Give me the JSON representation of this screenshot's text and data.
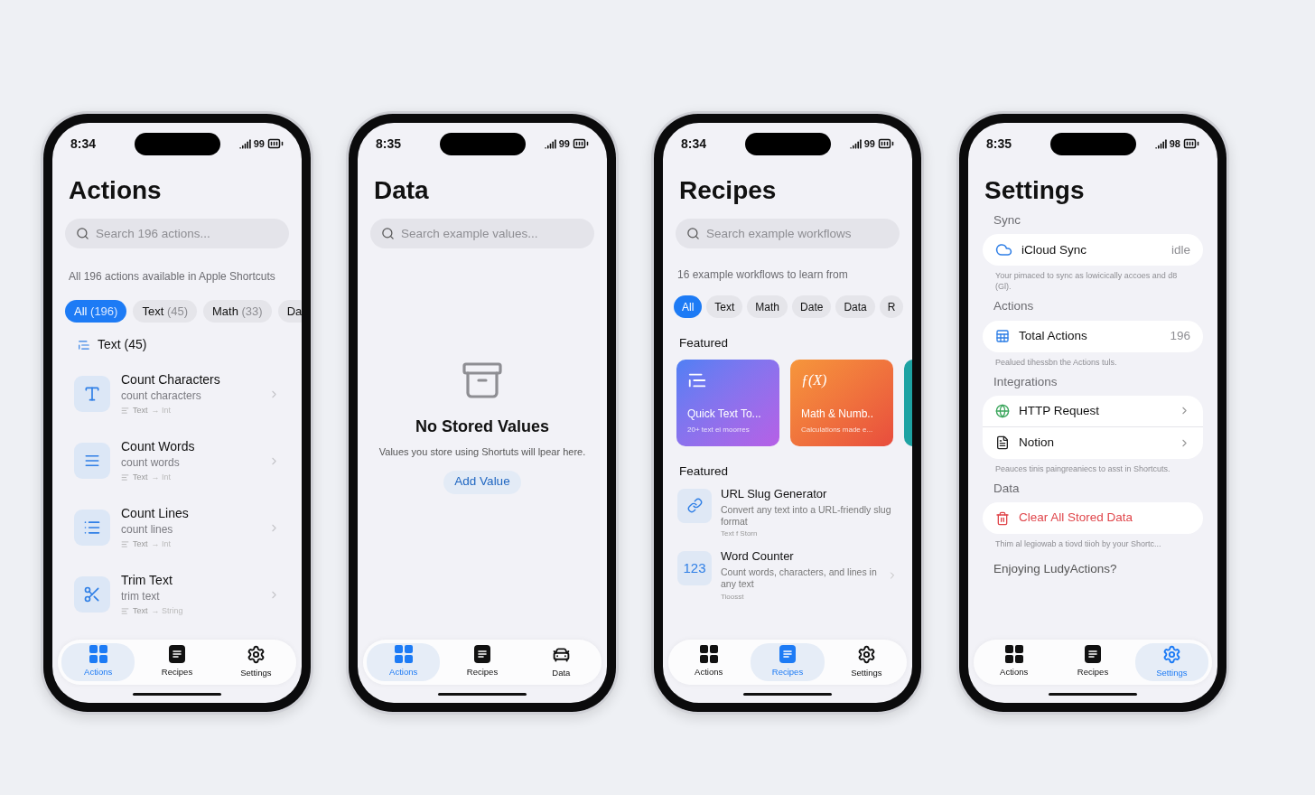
{
  "phones": [
    {
      "kind": "actions",
      "time": "8:34",
      "battery": "99",
      "title": "Actions",
      "search": {
        "placeholder": "Search 196 actions..."
      },
      "subtitle": "All 196 actions available in Apple Shortcuts",
      "chips": [
        {
          "label": "All",
          "count": "(196)",
          "selected": true
        },
        {
          "label": "Text",
          "count": "(45)",
          "selected": false
        },
        {
          "label": "Math",
          "count": "(33)",
          "selected": false
        },
        {
          "label": "Da",
          "selected": false
        }
      ],
      "section": "Text (45)",
      "items": [
        {
          "kind": "characters",
          "title": "Count Characters",
          "subtitle": "count characters",
          "input": "Text",
          "output": "→ Int"
        },
        {
          "kind": "words",
          "title": "Count Words",
          "subtitle": "count words",
          "input": "Text",
          "output": "→ Int"
        },
        {
          "kind": "lines",
          "title": "Count Lines",
          "subtitle": "count lines",
          "input": "Text",
          "output": "→ Int"
        },
        {
          "kind": "trim",
          "title": "Trim Text",
          "subtitle": "trim text",
          "input": "Text",
          "output": "→ String"
        }
      ],
      "tabs": [
        {
          "kind": "actions",
          "label": "Actions",
          "selected": true
        },
        {
          "kind": "recipes",
          "label": "Recipes",
          "selected": false
        },
        {
          "kind": "settings",
          "label": "Settings",
          "selected": false
        }
      ]
    },
    {
      "kind": "data",
      "time": "8:35",
      "battery": "99",
      "title": "Data",
      "search": {
        "placeholder": "Search example values..."
      },
      "empty": {
        "title": "No Stored Values",
        "message": "Values you store using Shortuts will lpear here.",
        "button": "Add Value"
      },
      "tabs": [
        {
          "kind": "actions",
          "label": "Actions",
          "selected": true
        },
        {
          "kind": "recipes",
          "label": "Recipes",
          "selected": false
        },
        {
          "kind": "data",
          "label": "Data",
          "selected": false
        }
      ]
    },
    {
      "kind": "recipes",
      "time": "8:34",
      "battery": "99",
      "title": "Recipes",
      "search": {
        "placeholder": "Search example workflows"
      },
      "subtitle": "16 example workflows to learn from",
      "chips": [
        {
          "label": "All",
          "selected": true
        },
        {
          "label": "Text",
          "selected": false
        },
        {
          "label": "Math",
          "selected": false
        },
        {
          "label": "Date",
          "selected": false
        },
        {
          "label": "Data",
          "selected": false
        },
        {
          "label": "R",
          "selected": false
        }
      ],
      "featured_heading": "Featured",
      "cards": [
        {
          "kind": "text",
          "title": "Quick Text To...",
          "subtitle": "20+ text ei moorres"
        },
        {
          "kind": "math",
          "glyph": "ƒ(X)",
          "title": "Math & Numb..",
          "subtitle": "Calculations made e..."
        },
        {
          "kind": "teal"
        }
      ],
      "list_heading": "Featured",
      "items": [
        {
          "kind": "link",
          "title": "URL Slug Generator",
          "description": "Convert any text into a URL-friendly slug format",
          "meta": "Text f Storn",
          "chevron": false
        },
        {
          "kind": "number",
          "glyph": "123",
          "title": "Word Counter",
          "description": "Count words, characters, and lines in any text",
          "meta": "Tioosst",
          "chevron": true
        }
      ],
      "tabs": [
        {
          "kind": "actions",
          "label": "Actions",
          "selected": false
        },
        {
          "kind": "recipes",
          "label": "Recipes",
          "selected": true
        },
        {
          "kind": "settings",
          "label": "Settings",
          "selected": false
        }
      ]
    },
    {
      "kind": "settings",
      "time": "8:35",
      "battery": "98",
      "title": "Settings",
      "groups": [
        {
          "header": "Sync",
          "rows": [
            {
              "kind": "cloud",
              "label": "iCloud Sync",
              "value": "idle",
              "destructive": false
            }
          ],
          "footer": "Your pimaced to sync as lowicically accoes and d8 (Gl)."
        },
        {
          "header": "Actions",
          "rows": [
            {
              "kind": "table",
              "label": "Total Actions",
              "value": "196",
              "destructive": false
            }
          ],
          "footer": "Pealued tihessbn the Actions tuls."
        },
        {
          "header": "Integrations",
          "rows": [
            {
              "kind": "globe",
              "label": "HTTP Request",
              "destructive": false
            },
            {
              "kind": "document",
              "label": "Notion",
              "destructive": false
            }
          ],
          "footer": "Peauces tinis paingreaniecs to asst in Shortcuts."
        },
        {
          "header": "Data",
          "rows": [
            {
              "kind": "trash",
              "label": "Clear All Stored Data",
              "destructive": true
            }
          ],
          "footer": "Thim al legiowab a tiovd tiioh by your Shortc..."
        }
      ],
      "closing": "Enjoying LudyActions?",
      "tabs": [
        {
          "kind": "actions",
          "label": "Actions",
          "selected": false
        },
        {
          "kind": "recipes",
          "label": "Recipes",
          "selected": false
        },
        {
          "kind": "settings",
          "label": "Settings",
          "selected": true
        }
      ]
    }
  ]
}
